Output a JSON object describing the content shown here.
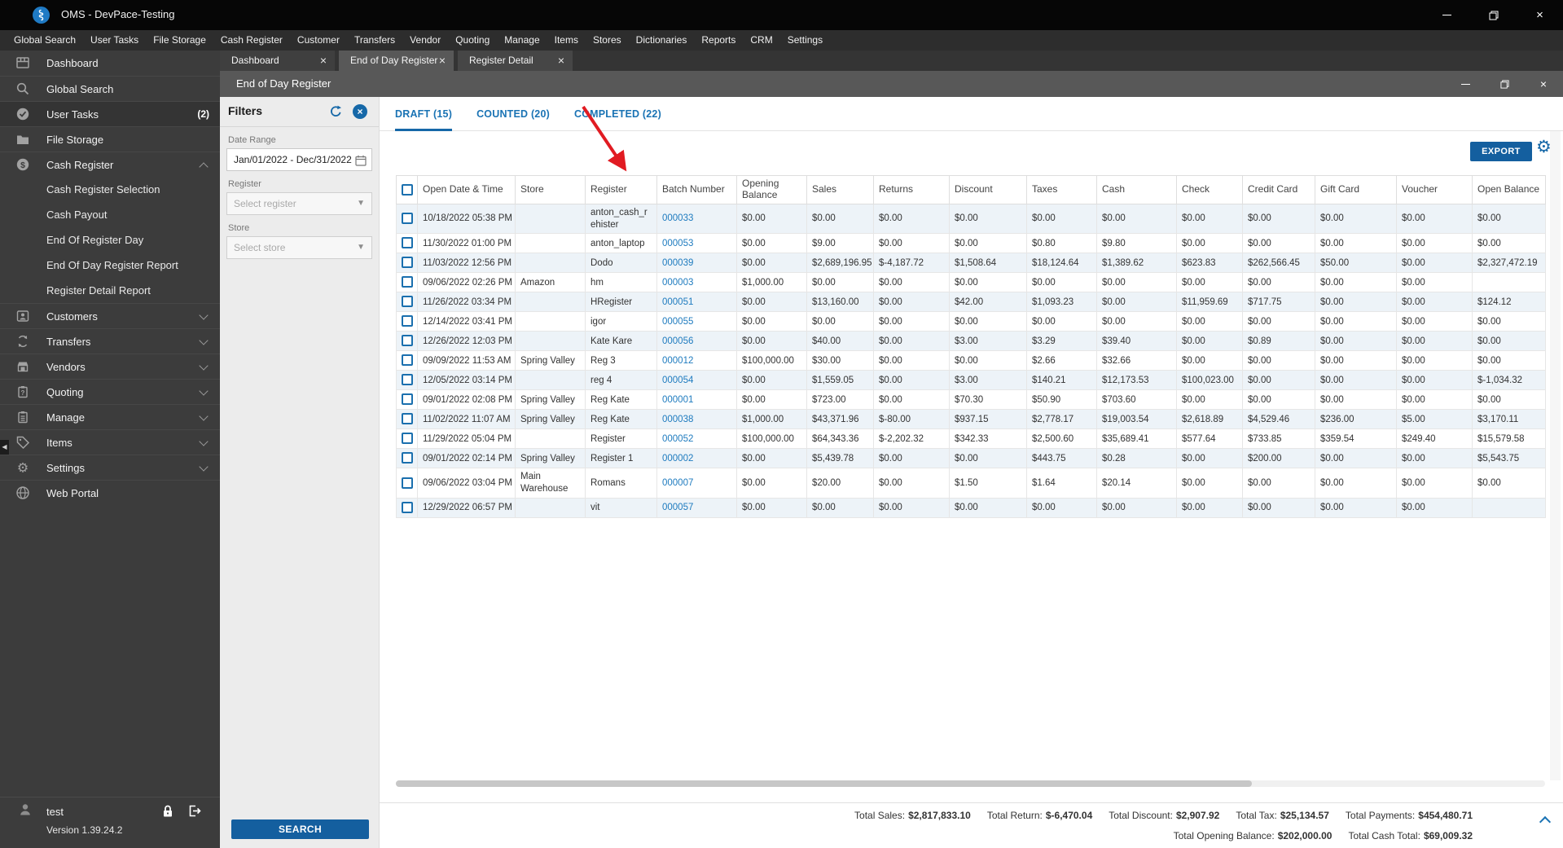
{
  "window": {
    "title": "OMS - DevPace-Testing"
  },
  "menu_bar": {
    "items": [
      "Global Search",
      "User Tasks",
      "File Storage",
      "Cash Register",
      "Customer",
      "Transfers",
      "Vendor",
      "Quoting",
      "Manage",
      "Items",
      "Stores",
      "Dictionaries",
      "Reports",
      "CRM",
      "Settings"
    ]
  },
  "sidebar": {
    "items": [
      {
        "label": "Dashboard",
        "icon": "dashboard-icon"
      },
      {
        "label": "Global Search",
        "icon": "search-icon"
      },
      {
        "label": "User Tasks",
        "icon": "tasks-icon",
        "badge": "(2)",
        "highlight": true
      },
      {
        "label": "File Storage",
        "icon": "storage-icon"
      },
      {
        "label": "Cash Register",
        "icon": "cash-register-icon",
        "chevron": "up",
        "children": [
          "Cash Register Selection",
          "Cash Payout",
          "End Of Register Day",
          "End Of Day Register Report",
          "Register Detail Report"
        ]
      },
      {
        "label": "Customers",
        "icon": "customers-icon",
        "chevron": "down"
      },
      {
        "label": "Transfers",
        "icon": "transfers-icon",
        "chevron": "down"
      },
      {
        "label": "Vendors",
        "icon": "vendors-icon",
        "chevron": "down"
      },
      {
        "label": "Quoting",
        "icon": "quoting-icon",
        "chevron": "down"
      },
      {
        "label": "Manage",
        "icon": "manage-icon",
        "chevron": "down"
      },
      {
        "label": "Items",
        "icon": "items-icon",
        "chevron": "down"
      },
      {
        "label": "Settings",
        "icon": "settings-icon",
        "chevron": "down"
      },
      {
        "label": "Web Portal",
        "icon": "web-portal-icon"
      }
    ],
    "footer": {
      "user": "test",
      "version": "Version 1.39.24.2"
    }
  },
  "tabs": [
    {
      "label": "Dashboard",
      "active": false
    },
    {
      "label": "End of Day Register",
      "active": true
    },
    {
      "label": "Register Detail",
      "active": false
    }
  ],
  "page": {
    "title": "End of Day Register"
  },
  "filters": {
    "title": "Filters",
    "date_range_label": "Date Range",
    "date_range_value": "Jan/01/2022 - Dec/31/2022",
    "register_label": "Register",
    "register_placeholder": "Select register",
    "store_label": "Store",
    "store_placeholder": "Select store",
    "search_label": "SEARCH"
  },
  "status_tabs": [
    {
      "label": "DRAFT (15)",
      "active": true
    },
    {
      "label": "COUNTED (20)",
      "active": false
    },
    {
      "label": "COMPLETED (22)",
      "active": false
    }
  ],
  "toolbar": {
    "export_label": "EXPORT"
  },
  "table": {
    "columns": [
      "",
      "Open Date & Time",
      "Store",
      "Register",
      "Batch Number",
      "Opening Balance",
      "Sales",
      "Returns",
      "Discount",
      "Taxes",
      "Cash",
      "Check",
      "Credit Card",
      "Gift Card",
      "Voucher",
      "Open Balance"
    ],
    "rows": [
      {
        "date": "10/18/2022 05:38 PM",
        "store": "",
        "register": "anton_cash_rehister",
        "batch": "000033",
        "values": [
          "$0.00",
          "$0.00",
          "$0.00",
          "$0.00",
          "$0.00",
          "$0.00",
          "$0.00",
          "$0.00",
          "$0.00",
          "$0.00",
          "$0.00"
        ]
      },
      {
        "date": "11/30/2022 01:00 PM",
        "store": "",
        "register": "anton_laptop",
        "batch": "000053",
        "values": [
          "$0.00",
          "$9.00",
          "$0.00",
          "$0.00",
          "$0.80",
          "$9.80",
          "$0.00",
          "$0.00",
          "$0.00",
          "$0.00",
          "$0.00"
        ]
      },
      {
        "date": "11/03/2022 12:56 PM",
        "store": "",
        "register": "Dodo",
        "batch": "000039",
        "values": [
          "$0.00",
          "$2,689,196.95",
          "$-4,187.72",
          "$1,508.64",
          "$18,124.64",
          "$1,389.62",
          "$623.83",
          "$262,566.45",
          "$50.00",
          "$0.00",
          "$2,327,472.19"
        ]
      },
      {
        "date": "09/06/2022 02:26 PM",
        "store": "Amazon",
        "register": "hm",
        "batch": "000003",
        "values": [
          "$1,000.00",
          "$0.00",
          "$0.00",
          "$0.00",
          "$0.00",
          "$0.00",
          "$0.00",
          "$0.00",
          "$0.00",
          "$0.00",
          ""
        ]
      },
      {
        "date": "11/26/2022 03:34 PM",
        "store": "",
        "register": "HRegister",
        "batch": "000051",
        "values": [
          "$0.00",
          "$13,160.00",
          "$0.00",
          "$42.00",
          "$1,093.23",
          "$0.00",
          "$11,959.69",
          "$717.75",
          "$0.00",
          "$0.00",
          "$124.12"
        ]
      },
      {
        "date": "12/14/2022 03:41 PM",
        "store": "",
        "register": "igor",
        "batch": "000055",
        "values": [
          "$0.00",
          "$0.00",
          "$0.00",
          "$0.00",
          "$0.00",
          "$0.00",
          "$0.00",
          "$0.00",
          "$0.00",
          "$0.00",
          "$0.00"
        ]
      },
      {
        "date": "12/26/2022 12:03 PM",
        "store": "",
        "register": "Kate Kare",
        "batch": "000056",
        "values": [
          "$0.00",
          "$40.00",
          "$0.00",
          "$3.00",
          "$3.29",
          "$39.40",
          "$0.00",
          "$0.89",
          "$0.00",
          "$0.00",
          "$0.00"
        ]
      },
      {
        "date": "09/09/2022 11:53 AM",
        "store": "Spring Valley",
        "register": "Reg 3",
        "batch": "000012",
        "values": [
          "$100,000.00",
          "$30.00",
          "$0.00",
          "$0.00",
          "$2.66",
          "$32.66",
          "$0.00",
          "$0.00",
          "$0.00",
          "$0.00",
          "$0.00"
        ]
      },
      {
        "date": "12/05/2022 03:14 PM",
        "store": "",
        "register": "reg 4",
        "batch": "000054",
        "values": [
          "$0.00",
          "$1,559.05",
          "$0.00",
          "$3.00",
          "$140.21",
          "$12,173.53",
          "$100,023.00",
          "$0.00",
          "$0.00",
          "$0.00",
          "$-1,034.32"
        ]
      },
      {
        "date": "09/01/2022 02:08 PM",
        "store": "Spring Valley",
        "register": "Reg Kate",
        "batch": "000001",
        "values": [
          "$0.00",
          "$723.00",
          "$0.00",
          "$70.30",
          "$50.90",
          "$703.60",
          "$0.00",
          "$0.00",
          "$0.00",
          "$0.00",
          "$0.00"
        ]
      },
      {
        "date": "11/02/2022 11:07 AM",
        "store": "Spring Valley",
        "register": "Reg Kate",
        "batch": "000038",
        "values": [
          "$1,000.00",
          "$43,371.96",
          "$-80.00",
          "$937.15",
          "$2,778.17",
          "$19,003.54",
          "$2,618.89",
          "$4,529.46",
          "$236.00",
          "$5.00",
          "$3,170.11"
        ]
      },
      {
        "date": "11/29/2022 05:04 PM",
        "store": "",
        "register": "Register",
        "batch": "000052",
        "values": [
          "$100,000.00",
          "$64,343.36",
          "$-2,202.32",
          "$342.33",
          "$2,500.60",
          "$35,689.41",
          "$577.64",
          "$733.85",
          "$359.54",
          "$249.40",
          "$15,579.58"
        ]
      },
      {
        "date": "09/01/2022 02:14 PM",
        "store": "Spring Valley",
        "register": "Register 1",
        "batch": "000002",
        "values": [
          "$0.00",
          "$5,439.78",
          "$0.00",
          "$0.00",
          "$443.75",
          "$0.28",
          "$0.00",
          "$200.00",
          "$0.00",
          "$0.00",
          "$5,543.75"
        ]
      },
      {
        "date": "09/06/2022 03:04 PM",
        "store": "Main Warehouse",
        "register": "Romans",
        "batch": "000007",
        "values": [
          "$0.00",
          "$20.00",
          "$0.00",
          "$1.50",
          "$1.64",
          "$20.14",
          "$0.00",
          "$0.00",
          "$0.00",
          "$0.00",
          "$0.00"
        ]
      },
      {
        "date": "12/29/2022 06:57 PM",
        "store": "",
        "register": "vit",
        "batch": "000057",
        "values": [
          "$0.00",
          "$0.00",
          "$0.00",
          "$0.00",
          "$0.00",
          "$0.00",
          "$0.00",
          "$0.00",
          "$0.00",
          "$0.00",
          ""
        ]
      }
    ]
  },
  "totals": {
    "line1": [
      {
        "label": "Total Sales:",
        "value": "$2,817,833.10"
      },
      {
        "label": "Total Return:",
        "value": "$-6,470.04"
      },
      {
        "label": "Total Discount:",
        "value": "$2,907.92"
      },
      {
        "label": "Total Tax:",
        "value": "$25,134.57"
      },
      {
        "label": "Total Payments:",
        "value": "$454,480.71"
      }
    ],
    "line2": [
      {
        "label": "Total Opening Balance:",
        "value": "$202,000.00"
      },
      {
        "label": "Total Cash Total:",
        "value": "$69,009.32"
      }
    ]
  },
  "colors": {
    "accent": "#1668a8",
    "link": "#1e7bbf",
    "row_alt": "#edf3f8",
    "annotation_arrow": "#e11b22"
  }
}
